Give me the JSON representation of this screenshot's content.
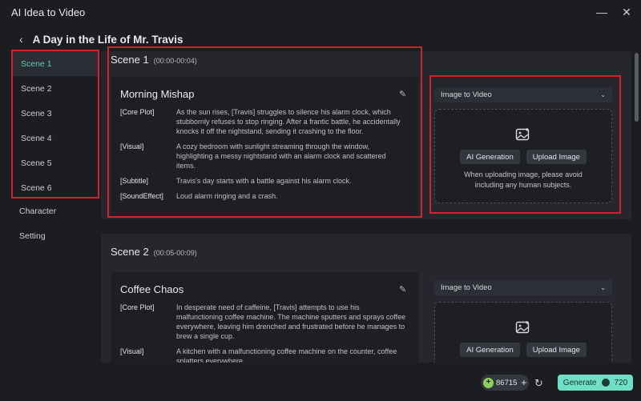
{
  "window": {
    "title": "AI Idea to Video",
    "minimize": "—",
    "close": "✕"
  },
  "header": {
    "back_icon": "back-chevron-icon",
    "title": "A Day in the Life of Mr. Travis"
  },
  "sidebar": {
    "scenes": [
      {
        "label": "Scene 1",
        "active": true
      },
      {
        "label": "Scene 2"
      },
      {
        "label": "Scene 3"
      },
      {
        "label": "Scene 4"
      },
      {
        "label": "Scene 5"
      },
      {
        "label": "Scene 6"
      }
    ],
    "character": "Character",
    "setting": "Setting"
  },
  "scenes": [
    {
      "name": "Scene 1",
      "time": "(00:00-00:04)",
      "title": "Morning Mishap",
      "rows": [
        {
          "label": "[Core Plot]",
          "value": "As the sun rises, [Travis] struggles to silence his alarm clock, which stubbornly refuses to stop ringing. After a frantic battle, he accidentally knocks it off the nightstand, sending it crashing to the floor."
        },
        {
          "label": "[Visual]",
          "value": "A cozy bedroom with sunlight streaming through the window, highlighting a messy nightstand with an alarm clock and scattered items."
        },
        {
          "label": "[Subtitle]",
          "value": "Travis's day starts with a battle against his alarm clock."
        },
        {
          "label": "[SoundEffect]",
          "value": "Loud alarm ringing and a crash."
        }
      ],
      "mode": "Image to Video",
      "ai_generation": "AI Generation",
      "upload_image": "Upload Image",
      "hint": "When uploading image, please avoid including any human subjects."
    },
    {
      "name": "Scene 2",
      "time": "(00:05-00:09)",
      "title": "Coffee Chaos",
      "rows": [
        {
          "label": "[Core Plot]",
          "value": "In desperate need of caffeine, [Travis] attempts to use his malfunctioning coffee machine. The machine sputters and sprays coffee everywhere, leaving him drenched and frustrated before he manages to brew a single cup."
        },
        {
          "label": "[Visual]",
          "value": "A kitchen with a malfunctioning coffee machine on the counter, coffee splatters everywhere."
        }
      ],
      "mode": "Image to Video",
      "ai_generation": "AI Generation",
      "upload_image": "Upload Image"
    }
  ],
  "footer": {
    "credits": "86715",
    "plus": "+",
    "generate_label": "Generate",
    "generate_cost": "720"
  },
  "colors": {
    "accent": "#6fe0c6",
    "highlight_box": "#d2222c",
    "active_text": "#5ed0b5"
  }
}
